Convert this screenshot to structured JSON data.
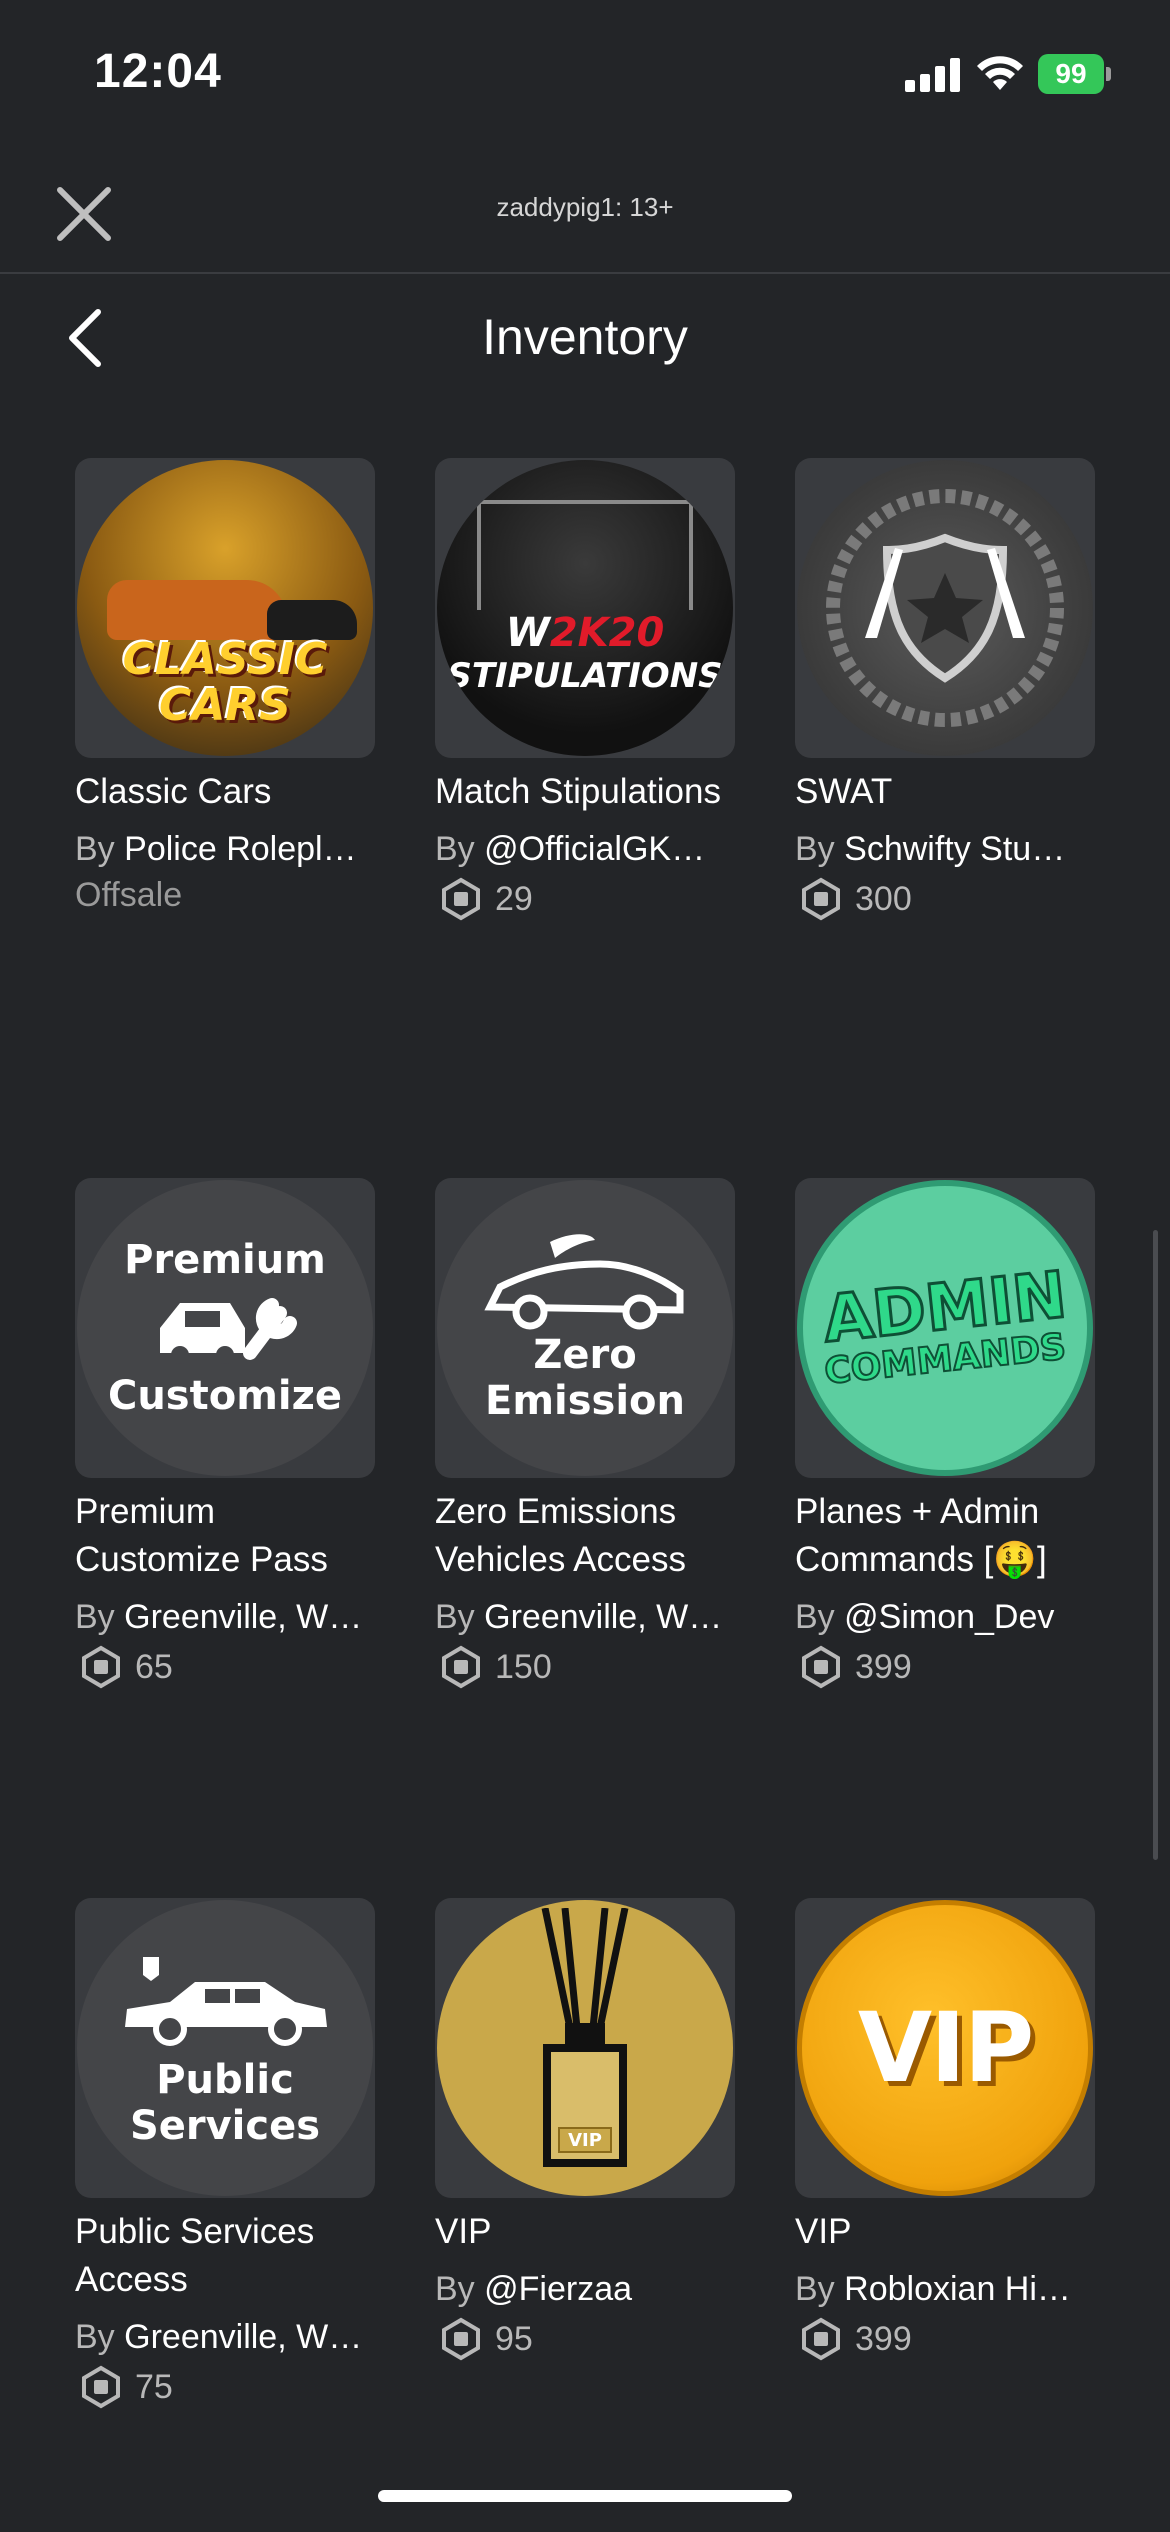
{
  "status_bar": {
    "time": "12:04",
    "battery": "99"
  },
  "header": {
    "user_label": "zaddypig1: 13+"
  },
  "nav": {
    "title": "Inventory"
  },
  "by_prefix": "By",
  "colors": {
    "background": "#232528",
    "card": "#393b3f",
    "text_secondary": "#b8b8b8",
    "battery": "#34c759"
  },
  "items": [
    {
      "name": "Classic Cars",
      "creator": "Police Rolepl…",
      "status": "Offsale",
      "price": null,
      "art_text": "CLASSIC CARS"
    },
    {
      "name": "Match Stipulations",
      "creator": "@OfficialGK…",
      "status": null,
      "price": "29",
      "art_logo_a": "W",
      "art_logo_b": "2K20",
      "art_sub": "STIPULATIONS"
    },
    {
      "name": "SWAT",
      "creator": "Schwifty Stu…",
      "status": null,
      "price": "300"
    },
    {
      "name": "Premium Customize Pass",
      "creator": "Greenville, W…",
      "status": null,
      "price": "65",
      "art_top": "Premium",
      "art_bottom": "Customize"
    },
    {
      "name": "Zero Emissions Vehicles Access",
      "creator": "Greenville, W…",
      "status": null,
      "price": "150",
      "art_top": "Zero",
      "art_bottom": "Emission"
    },
    {
      "name": "Planes + Admin Commands [🤑]",
      "creator": "@Simon_Dev",
      "status": null,
      "price": "399",
      "art_top": "ADMIN",
      "art_bottom": "COMMANDS"
    },
    {
      "name": "Public Services Access",
      "creator": "Greenville, W…",
      "status": null,
      "price": "75",
      "art_top": "Public",
      "art_bottom": "Services"
    },
    {
      "name": "VIP",
      "creator": "@Fierzaa",
      "status": null,
      "price": "95",
      "art_text": "VIP"
    },
    {
      "name": "VIP",
      "creator": "Robloxian Hi…",
      "status": null,
      "price": "399",
      "art_text": "VIP"
    }
  ]
}
